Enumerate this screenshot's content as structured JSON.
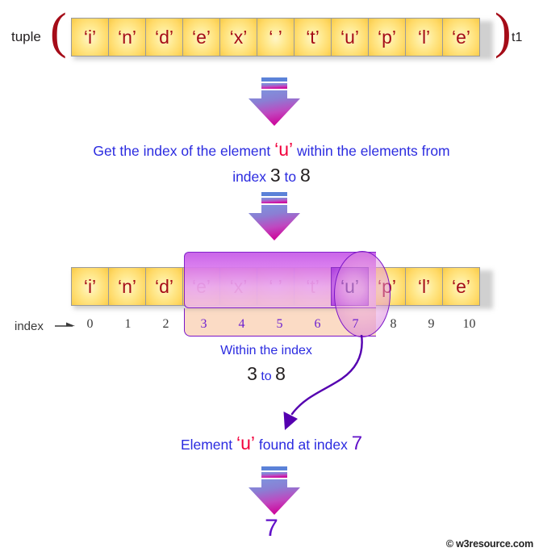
{
  "diagram": {
    "tuple_label": "tuple",
    "paren_open": "(",
    "paren_close": ")",
    "variable_name": "t1",
    "elements": [
      "‘i’",
      "‘n’",
      "‘d’",
      "‘e’",
      "‘x’",
      "‘ ’",
      "‘t’",
      "‘u’",
      "‘p’",
      "‘l’",
      "‘e’"
    ],
    "indices": [
      "0",
      "1",
      "2",
      "3",
      "4",
      "5",
      "6",
      "7",
      "8",
      "9",
      "10"
    ],
    "index_word": "index",
    "highlight_start": 3,
    "highlight_end": 7,
    "selected_index": 7
  },
  "step1": {
    "line1_pre": "Get the index of the element ",
    "line1_target": "‘u’",
    "line1_post": " within the elements from",
    "line2_pre": "index ",
    "line2_start": "3",
    "line2_mid": " to ",
    "line2_end": "8"
  },
  "step2": {
    "line1": "Within the index",
    "line2_start": "3",
    "line2_mid": " to ",
    "line2_end": "8"
  },
  "step3": {
    "pre": "Element ",
    "target": "‘u’",
    "mid": " found at index ",
    "value": "7"
  },
  "result": {
    "value": "7"
  },
  "footer": {
    "text": "© w3resource.com"
  },
  "colors": {
    "cell_fill": "#ffd966",
    "cell_text": "#a50c18",
    "caption_blue": "#2b2be0",
    "target_red": "#f2003c",
    "highlight_purple": "#7a14c8",
    "result_purple": "#6010c8",
    "paren_red": "#a50c18",
    "arrow_top_blue": "#5b82d8",
    "arrow_bottom_magenta": "#cc18a8"
  }
}
